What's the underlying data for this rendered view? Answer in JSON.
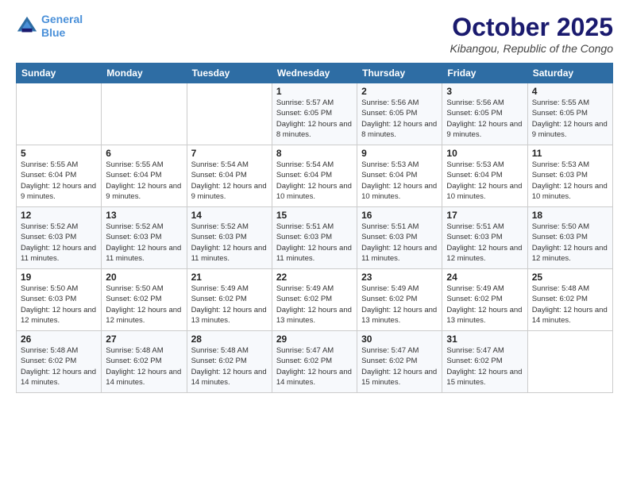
{
  "logo": {
    "line1": "General",
    "line2": "Blue"
  },
  "header": {
    "month": "October 2025",
    "location": "Kibangou, Republic of the Congo"
  },
  "weekdays": [
    "Sunday",
    "Monday",
    "Tuesday",
    "Wednesday",
    "Thursday",
    "Friday",
    "Saturday"
  ],
  "weeks": [
    [
      {
        "day": "",
        "sunrise": "",
        "sunset": "",
        "daylight": ""
      },
      {
        "day": "",
        "sunrise": "",
        "sunset": "",
        "daylight": ""
      },
      {
        "day": "",
        "sunrise": "",
        "sunset": "",
        "daylight": ""
      },
      {
        "day": "1",
        "sunrise": "Sunrise: 5:57 AM",
        "sunset": "Sunset: 6:05 PM",
        "daylight": "Daylight: 12 hours and 8 minutes."
      },
      {
        "day": "2",
        "sunrise": "Sunrise: 5:56 AM",
        "sunset": "Sunset: 6:05 PM",
        "daylight": "Daylight: 12 hours and 8 minutes."
      },
      {
        "day": "3",
        "sunrise": "Sunrise: 5:56 AM",
        "sunset": "Sunset: 6:05 PM",
        "daylight": "Daylight: 12 hours and 9 minutes."
      },
      {
        "day": "4",
        "sunrise": "Sunrise: 5:55 AM",
        "sunset": "Sunset: 6:05 PM",
        "daylight": "Daylight: 12 hours and 9 minutes."
      }
    ],
    [
      {
        "day": "5",
        "sunrise": "Sunrise: 5:55 AM",
        "sunset": "Sunset: 6:04 PM",
        "daylight": "Daylight: 12 hours and 9 minutes."
      },
      {
        "day": "6",
        "sunrise": "Sunrise: 5:55 AM",
        "sunset": "Sunset: 6:04 PM",
        "daylight": "Daylight: 12 hours and 9 minutes."
      },
      {
        "day": "7",
        "sunrise": "Sunrise: 5:54 AM",
        "sunset": "Sunset: 6:04 PM",
        "daylight": "Daylight: 12 hours and 9 minutes."
      },
      {
        "day": "8",
        "sunrise": "Sunrise: 5:54 AM",
        "sunset": "Sunset: 6:04 PM",
        "daylight": "Daylight: 12 hours and 10 minutes."
      },
      {
        "day": "9",
        "sunrise": "Sunrise: 5:53 AM",
        "sunset": "Sunset: 6:04 PM",
        "daylight": "Daylight: 12 hours and 10 minutes."
      },
      {
        "day": "10",
        "sunrise": "Sunrise: 5:53 AM",
        "sunset": "Sunset: 6:04 PM",
        "daylight": "Daylight: 12 hours and 10 minutes."
      },
      {
        "day": "11",
        "sunrise": "Sunrise: 5:53 AM",
        "sunset": "Sunset: 6:03 PM",
        "daylight": "Daylight: 12 hours and 10 minutes."
      }
    ],
    [
      {
        "day": "12",
        "sunrise": "Sunrise: 5:52 AM",
        "sunset": "Sunset: 6:03 PM",
        "daylight": "Daylight: 12 hours and 11 minutes."
      },
      {
        "day": "13",
        "sunrise": "Sunrise: 5:52 AM",
        "sunset": "Sunset: 6:03 PM",
        "daylight": "Daylight: 12 hours and 11 minutes."
      },
      {
        "day": "14",
        "sunrise": "Sunrise: 5:52 AM",
        "sunset": "Sunset: 6:03 PM",
        "daylight": "Daylight: 12 hours and 11 minutes."
      },
      {
        "day": "15",
        "sunrise": "Sunrise: 5:51 AM",
        "sunset": "Sunset: 6:03 PM",
        "daylight": "Daylight: 12 hours and 11 minutes."
      },
      {
        "day": "16",
        "sunrise": "Sunrise: 5:51 AM",
        "sunset": "Sunset: 6:03 PM",
        "daylight": "Daylight: 12 hours and 11 minutes."
      },
      {
        "day": "17",
        "sunrise": "Sunrise: 5:51 AM",
        "sunset": "Sunset: 6:03 PM",
        "daylight": "Daylight: 12 hours and 12 minutes."
      },
      {
        "day": "18",
        "sunrise": "Sunrise: 5:50 AM",
        "sunset": "Sunset: 6:03 PM",
        "daylight": "Daylight: 12 hours and 12 minutes."
      }
    ],
    [
      {
        "day": "19",
        "sunrise": "Sunrise: 5:50 AM",
        "sunset": "Sunset: 6:03 PM",
        "daylight": "Daylight: 12 hours and 12 minutes."
      },
      {
        "day": "20",
        "sunrise": "Sunrise: 5:50 AM",
        "sunset": "Sunset: 6:02 PM",
        "daylight": "Daylight: 12 hours and 12 minutes."
      },
      {
        "day": "21",
        "sunrise": "Sunrise: 5:49 AM",
        "sunset": "Sunset: 6:02 PM",
        "daylight": "Daylight: 12 hours and 13 minutes."
      },
      {
        "day": "22",
        "sunrise": "Sunrise: 5:49 AM",
        "sunset": "Sunset: 6:02 PM",
        "daylight": "Daylight: 12 hours and 13 minutes."
      },
      {
        "day": "23",
        "sunrise": "Sunrise: 5:49 AM",
        "sunset": "Sunset: 6:02 PM",
        "daylight": "Daylight: 12 hours and 13 minutes."
      },
      {
        "day": "24",
        "sunrise": "Sunrise: 5:49 AM",
        "sunset": "Sunset: 6:02 PM",
        "daylight": "Daylight: 12 hours and 13 minutes."
      },
      {
        "day": "25",
        "sunrise": "Sunrise: 5:48 AM",
        "sunset": "Sunset: 6:02 PM",
        "daylight": "Daylight: 12 hours and 14 minutes."
      }
    ],
    [
      {
        "day": "26",
        "sunrise": "Sunrise: 5:48 AM",
        "sunset": "Sunset: 6:02 PM",
        "daylight": "Daylight: 12 hours and 14 minutes."
      },
      {
        "day": "27",
        "sunrise": "Sunrise: 5:48 AM",
        "sunset": "Sunset: 6:02 PM",
        "daylight": "Daylight: 12 hours and 14 minutes."
      },
      {
        "day": "28",
        "sunrise": "Sunrise: 5:48 AM",
        "sunset": "Sunset: 6:02 PM",
        "daylight": "Daylight: 12 hours and 14 minutes."
      },
      {
        "day": "29",
        "sunrise": "Sunrise: 5:47 AM",
        "sunset": "Sunset: 6:02 PM",
        "daylight": "Daylight: 12 hours and 14 minutes."
      },
      {
        "day": "30",
        "sunrise": "Sunrise: 5:47 AM",
        "sunset": "Sunset: 6:02 PM",
        "daylight": "Daylight: 12 hours and 15 minutes."
      },
      {
        "day": "31",
        "sunrise": "Sunrise: 5:47 AM",
        "sunset": "Sunset: 6:02 PM",
        "daylight": "Daylight: 12 hours and 15 minutes."
      },
      {
        "day": "",
        "sunrise": "",
        "sunset": "",
        "daylight": ""
      }
    ]
  ]
}
